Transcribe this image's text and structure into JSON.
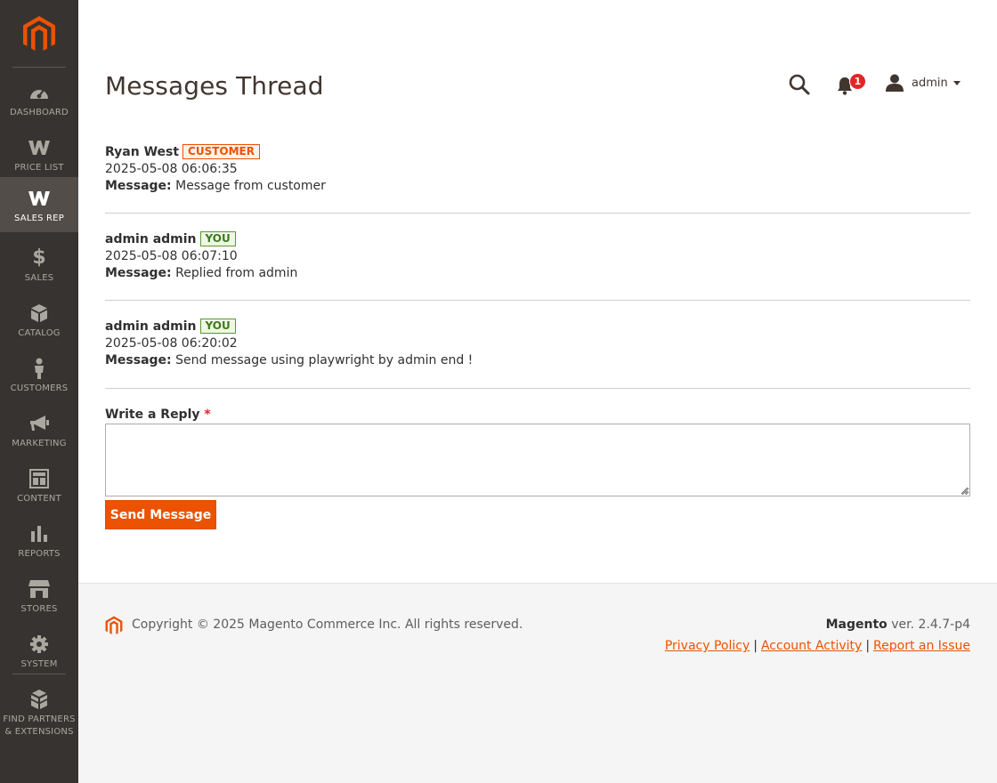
{
  "sidebar": {
    "items": [
      {
        "label": "DASHBOARD",
        "icon": "dashboard-icon"
      },
      {
        "label": "PRICE LIST",
        "icon": "price-list-icon"
      },
      {
        "label": "SALES REP",
        "icon": "sales-rep-icon"
      },
      {
        "label": "SALES",
        "icon": "dollar-icon"
      },
      {
        "label": "CATALOG",
        "icon": "cube-icon"
      },
      {
        "label": "CUSTOMERS",
        "icon": "person-icon"
      },
      {
        "label": "MARKETING",
        "icon": "megaphone-icon"
      },
      {
        "label": "CONTENT",
        "icon": "layout-icon"
      },
      {
        "label": "REPORTS",
        "icon": "bar-chart-icon"
      },
      {
        "label": "STORES",
        "icon": "store-icon"
      },
      {
        "label": "SYSTEM",
        "icon": "gear-icon"
      },
      {
        "label": "FIND PARTNERS & EXTENSIONS",
        "icon": "blocks-icon"
      }
    ],
    "active": "SALES REP"
  },
  "header": {
    "title": "Messages Thread",
    "notification_count": "1",
    "user_name": "admin"
  },
  "messages": [
    {
      "author": "Ryan West",
      "tag": "CUSTOMER",
      "timestamp": "2025-05-08 06:06:35",
      "label": "Message:",
      "text": "Message from customer"
    },
    {
      "author": "admin admin",
      "tag": "YOU",
      "timestamp": "2025-05-08 06:07:10",
      "label": "Message:",
      "text": "Replied from admin"
    },
    {
      "author": "admin admin",
      "tag": "YOU",
      "timestamp": "2025-05-08 06:20:02",
      "label": "Message:",
      "text": "Send message using playwright by admin end !"
    }
  ],
  "reply": {
    "label": "Write a Reply",
    "required_mark": "*",
    "value": "",
    "button_label": "Send Message"
  },
  "footer": {
    "copyright": "Copyright © 2025 Magento Commerce Inc. All rights reserved.",
    "brand": "Magento",
    "version": "ver. 2.4.7-p4",
    "links": {
      "privacy": "Privacy Policy",
      "account_activity": "Account Activity",
      "report_issue": "Report an Issue",
      "separator": "|"
    }
  },
  "colors": {
    "accent": "#eb5202",
    "sidebar_bg": "#373330",
    "sidebar_active_bg": "#524d49",
    "badge": "#e22626"
  }
}
